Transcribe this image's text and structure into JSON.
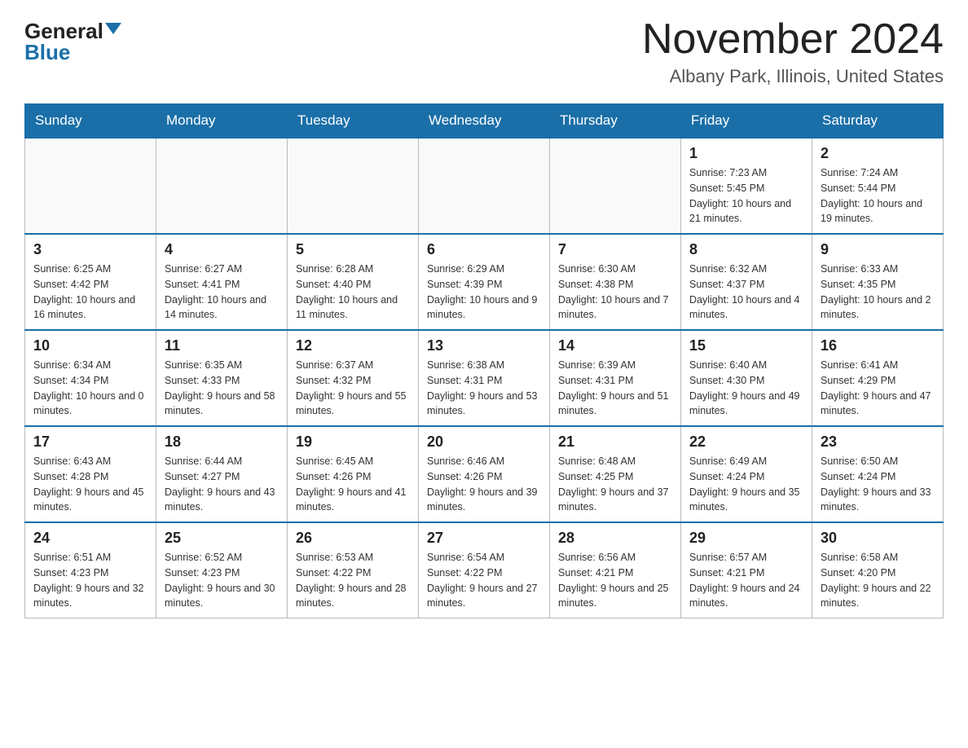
{
  "header": {
    "logo": {
      "general": "General",
      "blue": "Blue"
    },
    "month_title": "November 2024",
    "location": "Albany Park, Illinois, United States"
  },
  "days_of_week": [
    "Sunday",
    "Monday",
    "Tuesday",
    "Wednesday",
    "Thursday",
    "Friday",
    "Saturday"
  ],
  "weeks": [
    [
      {
        "day": "",
        "info": ""
      },
      {
        "day": "",
        "info": ""
      },
      {
        "day": "",
        "info": ""
      },
      {
        "day": "",
        "info": ""
      },
      {
        "day": "",
        "info": ""
      },
      {
        "day": "1",
        "info": "Sunrise: 7:23 AM\nSunset: 5:45 PM\nDaylight: 10 hours and 21 minutes."
      },
      {
        "day": "2",
        "info": "Sunrise: 7:24 AM\nSunset: 5:44 PM\nDaylight: 10 hours and 19 minutes."
      }
    ],
    [
      {
        "day": "3",
        "info": "Sunrise: 6:25 AM\nSunset: 4:42 PM\nDaylight: 10 hours and 16 minutes."
      },
      {
        "day": "4",
        "info": "Sunrise: 6:27 AM\nSunset: 4:41 PM\nDaylight: 10 hours and 14 minutes."
      },
      {
        "day": "5",
        "info": "Sunrise: 6:28 AM\nSunset: 4:40 PM\nDaylight: 10 hours and 11 minutes."
      },
      {
        "day": "6",
        "info": "Sunrise: 6:29 AM\nSunset: 4:39 PM\nDaylight: 10 hours and 9 minutes."
      },
      {
        "day": "7",
        "info": "Sunrise: 6:30 AM\nSunset: 4:38 PM\nDaylight: 10 hours and 7 minutes."
      },
      {
        "day": "8",
        "info": "Sunrise: 6:32 AM\nSunset: 4:37 PM\nDaylight: 10 hours and 4 minutes."
      },
      {
        "day": "9",
        "info": "Sunrise: 6:33 AM\nSunset: 4:35 PM\nDaylight: 10 hours and 2 minutes."
      }
    ],
    [
      {
        "day": "10",
        "info": "Sunrise: 6:34 AM\nSunset: 4:34 PM\nDaylight: 10 hours and 0 minutes."
      },
      {
        "day": "11",
        "info": "Sunrise: 6:35 AM\nSunset: 4:33 PM\nDaylight: 9 hours and 58 minutes."
      },
      {
        "day": "12",
        "info": "Sunrise: 6:37 AM\nSunset: 4:32 PM\nDaylight: 9 hours and 55 minutes."
      },
      {
        "day": "13",
        "info": "Sunrise: 6:38 AM\nSunset: 4:31 PM\nDaylight: 9 hours and 53 minutes."
      },
      {
        "day": "14",
        "info": "Sunrise: 6:39 AM\nSunset: 4:31 PM\nDaylight: 9 hours and 51 minutes."
      },
      {
        "day": "15",
        "info": "Sunrise: 6:40 AM\nSunset: 4:30 PM\nDaylight: 9 hours and 49 minutes."
      },
      {
        "day": "16",
        "info": "Sunrise: 6:41 AM\nSunset: 4:29 PM\nDaylight: 9 hours and 47 minutes."
      }
    ],
    [
      {
        "day": "17",
        "info": "Sunrise: 6:43 AM\nSunset: 4:28 PM\nDaylight: 9 hours and 45 minutes."
      },
      {
        "day": "18",
        "info": "Sunrise: 6:44 AM\nSunset: 4:27 PM\nDaylight: 9 hours and 43 minutes."
      },
      {
        "day": "19",
        "info": "Sunrise: 6:45 AM\nSunset: 4:26 PM\nDaylight: 9 hours and 41 minutes."
      },
      {
        "day": "20",
        "info": "Sunrise: 6:46 AM\nSunset: 4:26 PM\nDaylight: 9 hours and 39 minutes."
      },
      {
        "day": "21",
        "info": "Sunrise: 6:48 AM\nSunset: 4:25 PM\nDaylight: 9 hours and 37 minutes."
      },
      {
        "day": "22",
        "info": "Sunrise: 6:49 AM\nSunset: 4:24 PM\nDaylight: 9 hours and 35 minutes."
      },
      {
        "day": "23",
        "info": "Sunrise: 6:50 AM\nSunset: 4:24 PM\nDaylight: 9 hours and 33 minutes."
      }
    ],
    [
      {
        "day": "24",
        "info": "Sunrise: 6:51 AM\nSunset: 4:23 PM\nDaylight: 9 hours and 32 minutes."
      },
      {
        "day": "25",
        "info": "Sunrise: 6:52 AM\nSunset: 4:23 PM\nDaylight: 9 hours and 30 minutes."
      },
      {
        "day": "26",
        "info": "Sunrise: 6:53 AM\nSunset: 4:22 PM\nDaylight: 9 hours and 28 minutes."
      },
      {
        "day": "27",
        "info": "Sunrise: 6:54 AM\nSunset: 4:22 PM\nDaylight: 9 hours and 27 minutes."
      },
      {
        "day": "28",
        "info": "Sunrise: 6:56 AM\nSunset: 4:21 PM\nDaylight: 9 hours and 25 minutes."
      },
      {
        "day": "29",
        "info": "Sunrise: 6:57 AM\nSunset: 4:21 PM\nDaylight: 9 hours and 24 minutes."
      },
      {
        "day": "30",
        "info": "Sunrise: 6:58 AM\nSunset: 4:20 PM\nDaylight: 9 hours and 22 minutes."
      }
    ]
  ]
}
